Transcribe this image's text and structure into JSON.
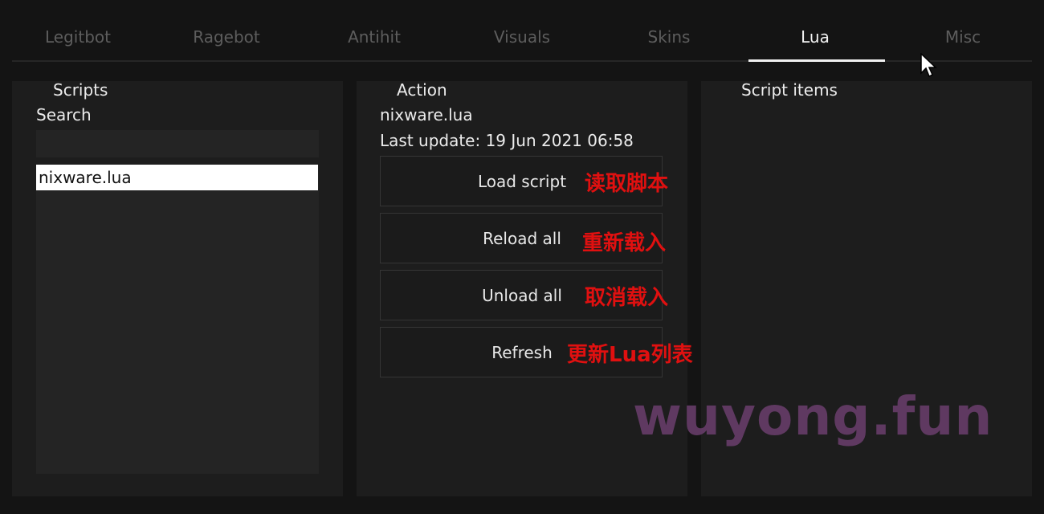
{
  "tabs": [
    "Legitbot",
    "Ragebot",
    "Antihit",
    "Visuals",
    "Skins",
    "Lua",
    "Misc"
  ],
  "active_tab": "Lua",
  "scripts_panel": {
    "title": "Scripts",
    "search_label": "Search",
    "search_value": "",
    "items": [
      "nixware.lua"
    ]
  },
  "action_panel": {
    "title": "Action",
    "script_name": "nixware.lua",
    "last_update": "Last update: 19 Jun 2021 06:58",
    "buttons": [
      {
        "label": "Load script",
        "annotation": "读取脚本"
      },
      {
        "label": "Reload all",
        "annotation": "重新载入"
      },
      {
        "label": "Unload all",
        "annotation": "取消载入"
      },
      {
        "label": "Refresh",
        "annotation": "更新Lua列表"
      }
    ]
  },
  "items_panel": {
    "title": "Script items"
  },
  "watermark": "wuyong.fun",
  "colors": {
    "background": "#141414",
    "panel": "#1d1d1d",
    "annotation": "#e01010",
    "watermark": "#6b3f6e"
  }
}
